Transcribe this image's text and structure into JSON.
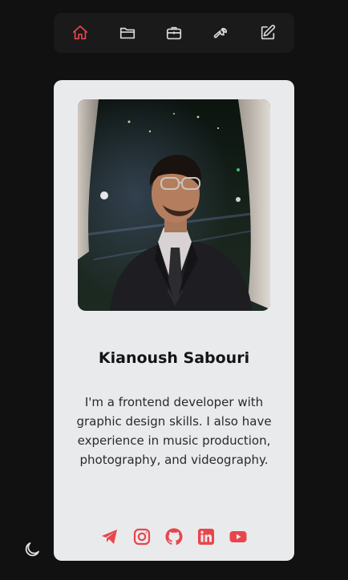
{
  "nav": {
    "items": [
      {
        "icon": "home-icon",
        "active": true
      },
      {
        "icon": "folder-icon",
        "active": false
      },
      {
        "icon": "briefcase-icon",
        "active": false
      },
      {
        "icon": "wrench-icon",
        "active": false
      },
      {
        "icon": "edit-icon",
        "active": false
      }
    ]
  },
  "profile": {
    "name": "Kianoush Sabouri",
    "bio": "I'm a frontend developer with graphic design skills. I also have experience in music production, photography, and videography."
  },
  "socials": [
    {
      "icon": "telegram-icon"
    },
    {
      "icon": "instagram-icon"
    },
    {
      "icon": "github-icon"
    },
    {
      "icon": "linkedin-icon"
    },
    {
      "icon": "youtube-icon"
    }
  ],
  "theme_toggle": {
    "icon": "moon-icon"
  },
  "colors": {
    "accent": "#e8464c",
    "nav_icon": "#d9d9d9",
    "background": "#121111",
    "card": "#e9eaec"
  }
}
